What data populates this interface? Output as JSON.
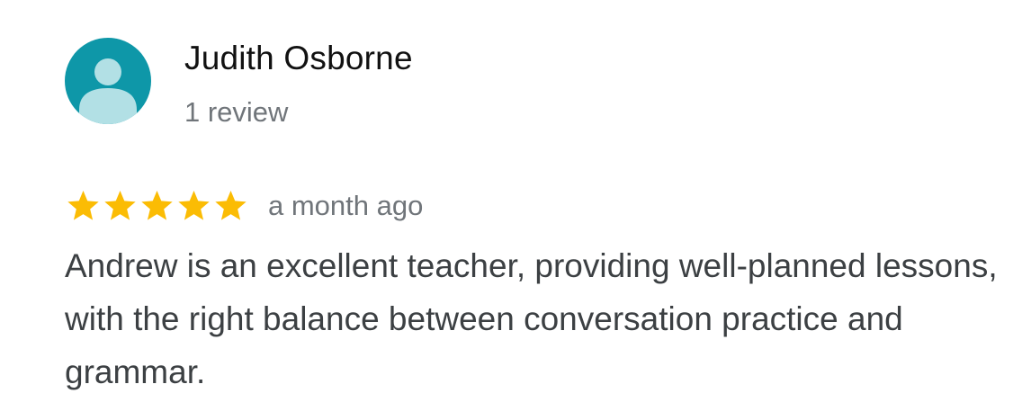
{
  "review": {
    "reviewer_name": "Judith Osborne",
    "review_count": "1 review",
    "rating": 5,
    "rating_max": 5,
    "time_ago": "a month ago",
    "text": "Andrew is an excellent teacher, providing well-planned lessons, with the right balance between conversation practice and grammar."
  },
  "colors": {
    "avatar_background": "#0e97a8",
    "avatar_figure": "#b2e0e5",
    "star": "#fbbc04",
    "name_text": "#111111",
    "secondary_text": "#70757a",
    "body_text": "#3c4043"
  },
  "icons": {
    "avatar": "person-avatar-icon",
    "star": "star-icon"
  }
}
